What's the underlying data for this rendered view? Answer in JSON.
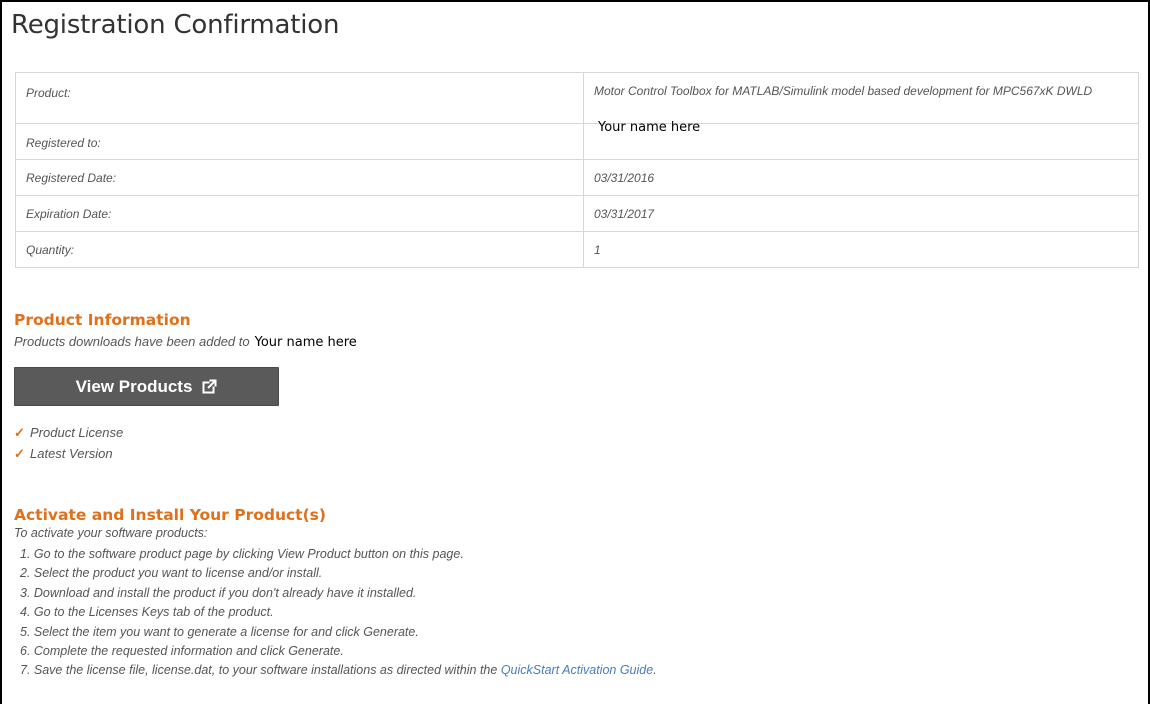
{
  "page": {
    "title": "Registration Confirmation"
  },
  "registration": {
    "rows": [
      {
        "label": "Product:",
        "value": "Motor Control Toolbox for MATLAB/Simulink model based development for MPC567xK DWLD"
      },
      {
        "label": "Registered to:",
        "value": "Your name here"
      },
      {
        "label": "Registered Date:",
        "value": "03/31/2016"
      },
      {
        "label": "Expiration Date:",
        "value": "03/31/2017"
      },
      {
        "label": "Quantity:",
        "value": "1"
      }
    ]
  },
  "product_info": {
    "heading": "Product Information",
    "added_text": "Products downloads have been added to",
    "owner": "Your name here",
    "view_button_label": "View Products",
    "view_button_icon": "external-link-icon",
    "checks": [
      {
        "icon": "checkmark-icon",
        "label": "Product License"
      },
      {
        "icon": "checkmark-icon",
        "label": "Latest Version"
      }
    ]
  },
  "activate": {
    "heading": "Activate and Install Your Product(s)",
    "intro": "To activate your software products:",
    "steps": [
      "1. Go to the software product page by clicking View Product button on this page.",
      "2. Select the product you want to license and/or install.",
      "3. Download and install the product if you don't already have it installed.",
      "4. Go to the Licenses Keys tab of the product.",
      "5. Select the item you want to generate a license for and click Generate.",
      "6. Complete the requested information and click Generate."
    ],
    "last_step_prefix": "7. Save the license file, license.dat, to your software installations as directed within the ",
    "last_step_link": "QuickStart Activation Guide",
    "last_step_suffix": "."
  },
  "colors": {
    "accent": "#e0701a",
    "button_bg": "#5a5a5a",
    "link": "#4a7bbf",
    "border": "#d7d7d7"
  }
}
